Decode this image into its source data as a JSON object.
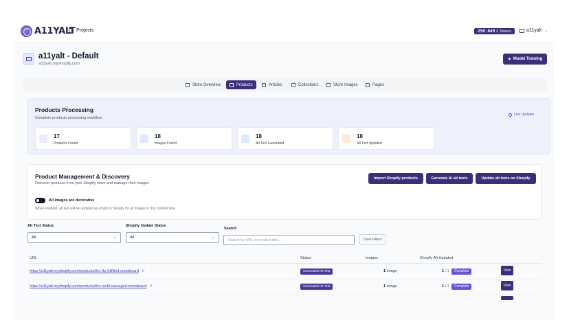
{
  "brand": {
    "name": "A11YALT"
  },
  "topbar": {
    "projects_label": "Projects",
    "tokens_value": "250.049",
    "tokens_suffix": "Z Tokens",
    "user_name": "a11yalt"
  },
  "store": {
    "title": "a11yalt - Default",
    "domain": "a11yalt.myshopify.com",
    "model_training_label": "Model Training"
  },
  "tabs": [
    {
      "label": "Store Overview",
      "active": false
    },
    {
      "label": "Products",
      "active": true
    },
    {
      "label": "Articles",
      "active": false
    },
    {
      "label": "Collections",
      "active": false
    },
    {
      "label": "Store Images",
      "active": false
    },
    {
      "label": "Pages",
      "active": false
    }
  ],
  "processing": {
    "title": "Products Processing",
    "subtitle": "Complete products processing workflow",
    "live_label": "Live Updates",
    "stats": [
      {
        "value": "17",
        "label": "Products Found",
        "icon": "shopping-bag-icon",
        "color": "#ede9fe"
      },
      {
        "value": "18",
        "label": "Images Found",
        "icon": "image-icon",
        "color": "#e0e7ff"
      },
      {
        "value": "18",
        "label": "Alt Text Generated",
        "icon": "sparkle-icon",
        "color": "#dbeafe"
      },
      {
        "value": "18",
        "label": "Alt Text Updated",
        "icon": "refresh-icon",
        "color": "#fde8d7"
      }
    ]
  },
  "management": {
    "title": "Product Management & Discovery",
    "subtitle": "Discover products from your Shopify store and manage their images",
    "import_label": "Import Shopify products",
    "generate_label": "Generate AI alt texts",
    "update_label": "Update alt texts on Shopify",
    "toggle_label": "All images are decorative",
    "toggle_help": "When enabled, alt text will be updated as empty to Shopify for all images in this content type."
  },
  "filters": {
    "alt_status_label": "Alt Text Status",
    "alt_status_value": "All",
    "shopify_status_label": "Shopify Update Status",
    "shopify_status_value": "All",
    "search_label": "Search",
    "search_placeholder": "Search by URL or product title...",
    "clear_label": "Clear Filters"
  },
  "table": {
    "headers": {
      "url": "URL",
      "status": "Status",
      "images": "Images",
      "updated": "Shopify Alt Updated"
    },
    "rows": [
      {
        "url": "https://a11yalt.myshopify.com/products/the-3p-fulfilled-snowboard",
        "status": "Generated Alt Text",
        "images_count": "1",
        "images_unit": "image",
        "updated_done": "1",
        "updated_total": "/ 1",
        "complete_label": "Complete",
        "view_label": "View"
      },
      {
        "url": "https://a11yalt.myshopify.com/products/the-multi-managed-snowboard",
        "status": "Generated Alt Text",
        "images_count": "1",
        "images_unit": "image",
        "updated_done": "1",
        "updated_total": "/ 1",
        "complete_label": "Complete",
        "view_label": "View"
      }
    ]
  },
  "colors": {
    "primary": "#3b2f7a",
    "accent": "#4f46e5",
    "panel": "#eef1fb"
  }
}
